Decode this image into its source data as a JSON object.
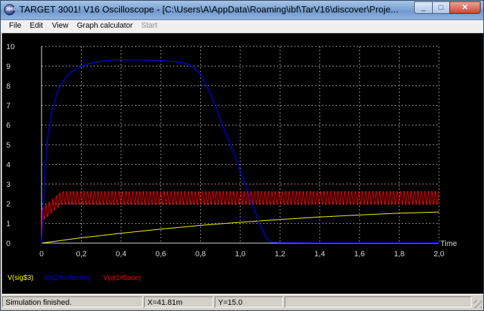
{
  "window": {
    "title": "TARGET 3001! V16 Oscilloscope - [C:\\Users\\A\\AppData\\Roaming\\ibf\\TarV16\\discover\\Proje...",
    "icon": "target-app-icon",
    "minimize": "_",
    "maximize": "□",
    "close": "✕"
  },
  "menu": {
    "file": "File",
    "edit": "Edit",
    "view": "View",
    "graph_calculator": "Graph calculator",
    "start": "Start"
  },
  "chart_data": {
    "type": "line",
    "background": "#000000",
    "grid": true,
    "xlabel": "Time",
    "ylabel": "",
    "xlim": [
      0,
      2.0
    ],
    "ylim": [
      0,
      10
    ],
    "x_ticks": [
      "0",
      "0,2",
      "0,4",
      "0,6",
      "0,8",
      "1,0",
      "1,2",
      "1,4",
      "1,6",
      "1,8",
      "2,0"
    ],
    "y_ticks": [
      "0",
      "1",
      "2",
      "3",
      "4",
      "5",
      "6",
      "7",
      "8",
      "9",
      "10"
    ],
    "legend_placement": "bottom-left",
    "series": [
      {
        "name": "V(sig$3)",
        "color": "#ffff00",
        "x": [
          0,
          0.2,
          0.4,
          0.6,
          0.8,
          1.0,
          1.2,
          1.4,
          1.6,
          1.8,
          2.0
        ],
        "y": [
          0,
          0.27,
          0.5,
          0.71,
          0.9,
          1.06,
          1.2,
          1.33,
          1.43,
          1.52,
          1.58
        ]
      },
      {
        "name": "V(q2#collector)",
        "color": "#0000ff",
        "x": [
          0,
          0.01,
          0.02,
          0.03,
          0.04,
          0.05,
          0.06,
          0.07,
          0.08,
          0.1,
          0.12,
          0.15,
          0.2,
          0.25,
          0.3,
          0.35,
          0.4,
          0.5,
          0.6,
          0.7,
          0.75,
          0.8,
          0.85,
          0.9,
          0.95,
          1.0,
          1.05,
          1.1,
          1.13,
          1.15,
          1.2,
          1.4,
          1.6,
          1.8,
          2.0
        ],
        "y": [
          0,
          2.0,
          3.9,
          5.2,
          6.0,
          6.6,
          7.0,
          7.3,
          7.7,
          8.1,
          8.4,
          8.7,
          9.0,
          9.15,
          9.25,
          9.3,
          9.32,
          9.3,
          9.28,
          9.2,
          9.05,
          8.6,
          7.6,
          6.3,
          5.0,
          3.7,
          2.3,
          0.9,
          0.3,
          0.05,
          0.03,
          0.02,
          0.02,
          0.02,
          0.02
        ]
      },
      {
        "name": "V(qt1#base)",
        "color": "#ff0000",
        "oscillation": {
          "center": 2.3,
          "amplitude": 0.35,
          "period": 0.0175,
          "settle_time": 0.1
        }
      }
    ]
  },
  "status": {
    "message": "Simulation finished.",
    "x_readout": "X=41.81m",
    "y_readout": "Y=15.0",
    "empty_pane": ""
  }
}
